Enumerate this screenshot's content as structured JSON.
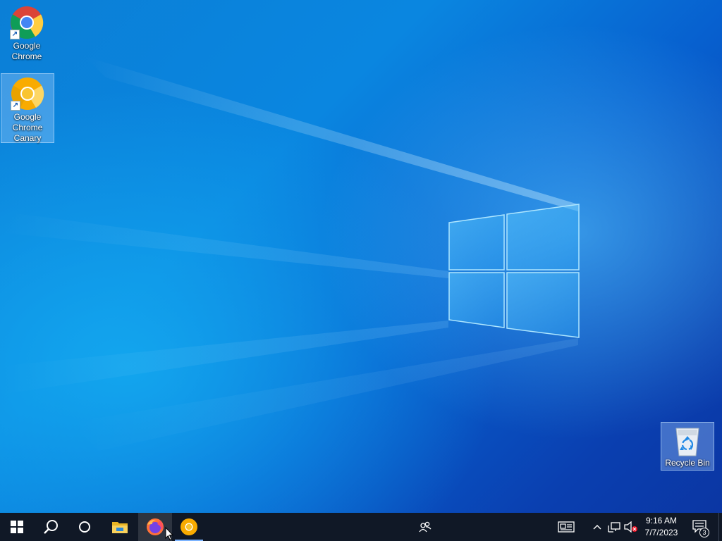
{
  "desktop": {
    "icons": [
      {
        "label": "Google Chrome",
        "icon": "chrome-icon",
        "shortcut": true
      },
      {
        "label": "Google Chrome Canary",
        "icon": "chrome-canary-icon",
        "shortcut": true,
        "selected": true
      },
      {
        "label": "Recycle Bin",
        "icon": "recycle-bin-icon",
        "shortcut": false,
        "selected": true
      }
    ]
  },
  "taskbar": {
    "start": "windows-start-icon",
    "search": "search-icon",
    "cortana": "cortana-icon",
    "pinned": [
      {
        "name": "file-explorer-icon",
        "running": false
      },
      {
        "name": "firefox-icon",
        "running": false,
        "active": true
      },
      {
        "name": "chrome-canary-taskbar-icon",
        "running": true
      }
    ],
    "people": "people-icon",
    "tray": {
      "news": "news-icon",
      "chevron": "chevron-up-icon",
      "network": "network-icon",
      "volume": "volume-muted-icon",
      "clock_time": "9:16 AM",
      "clock_date": "7/7/2023",
      "notifications_count": "3"
    }
  },
  "colors": {
    "accent": "#0a78d7",
    "taskbar": "#101826"
  }
}
